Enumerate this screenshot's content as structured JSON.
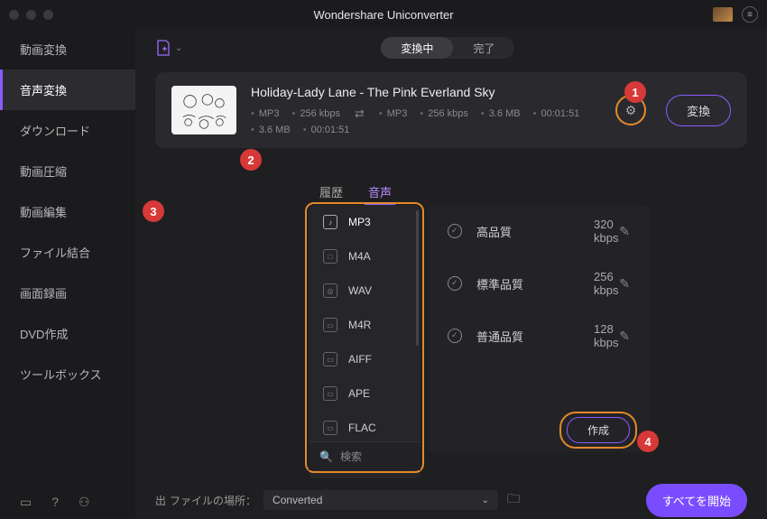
{
  "app": {
    "title": "Wondershare Uniconverter"
  },
  "sidebar": {
    "items": [
      {
        "label": "動画変換"
      },
      {
        "label": "音声変換"
      },
      {
        "label": "ダウンロード"
      },
      {
        "label": "動画圧縮"
      },
      {
        "label": "動画編集"
      },
      {
        "label": "ファイル結合"
      },
      {
        "label": "画面録画"
      },
      {
        "label": "DVD作成"
      },
      {
        "label": "ツールボックス"
      }
    ],
    "active_index": 1
  },
  "top_tabs": {
    "converting": "変換中",
    "done": "完了"
  },
  "file": {
    "name": "Holiday-Lady Lane - The Pink Everland Sky",
    "src": {
      "format": "MP3",
      "bitrate": "256 kbps",
      "size": "3.6 MB",
      "duration": "00:01:51"
    },
    "dst": {
      "format": "MP3",
      "bitrate": "256 kbps",
      "size": "3.6 MB",
      "duration": "00:01:51"
    },
    "convert_label": "変換"
  },
  "dropdown": {
    "tabs": {
      "history": "履歴",
      "audio": "音声"
    },
    "search": "検索",
    "create": "作成",
    "formats": [
      {
        "name": "MP3"
      },
      {
        "name": "M4A"
      },
      {
        "name": "WAV"
      },
      {
        "name": "M4R"
      },
      {
        "name": "AIFF"
      },
      {
        "name": "APE"
      },
      {
        "name": "FLAC"
      }
    ],
    "qualities": [
      {
        "label": "高品質",
        "bitrate": "320 kbps"
      },
      {
        "label": "標準品質",
        "bitrate": "256 kbps"
      },
      {
        "label": "普通品質",
        "bitrate": "128 kbps"
      }
    ]
  },
  "bottom": {
    "output_prefix": "出",
    "location_label": "ファイルの場所：",
    "location_value": "Converted",
    "start_all": "すべてを開始"
  },
  "steps": {
    "1": "1",
    "2": "2",
    "3": "3",
    "4": "4"
  }
}
